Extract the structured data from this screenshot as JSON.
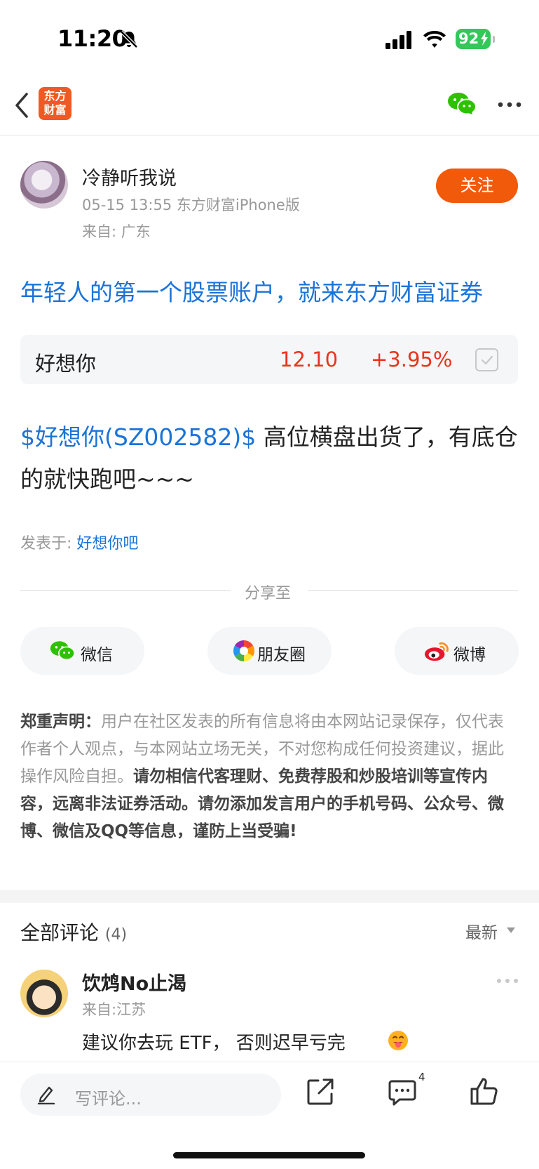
{
  "status_bar": {
    "time": "11:20",
    "battery": "92"
  },
  "nav": {
    "logo_text_line1": "东方",
    "logo_text_line2": "财富"
  },
  "post": {
    "author_name": "冷静听我说",
    "meta": "05-15 13:55 东方财富iPhone版",
    "location": "来自: 广东",
    "follow_label": "关注",
    "promo_link": "年轻人的第一个股票账户，就来东方财富证券",
    "stock": {
      "name": "好想你",
      "price": "12.10",
      "change": "+3.95%"
    },
    "stock_tag": "$好想你(SZ002582)$",
    "body_text": " 高位横盘出货了，有底仓的就快跑吧~~~",
    "posted_in_label": "发表于: ",
    "forum": "好想你吧"
  },
  "share": {
    "label": "分享至",
    "wechat": "微信",
    "moments": "朋友圈",
    "weibo": "微博"
  },
  "disclaimer": {
    "title": "郑重声明：",
    "normal": "用户在社区发表的所有信息将由本网站记录保存，仅代表作者个人观点，与本网站立场无关，不对您构成任何投资建议，据此操作风险自担。",
    "bold": "请勿相信代客理财、免费荐股和炒股培训等宣传内容，远离非法证券活动。请勿添加发言用户的手机号码、公众号、微博、微信及QQ等信息，谨防上当受骗!"
  },
  "comments": {
    "title": "全部评论",
    "count": "(4)",
    "sort": "最新",
    "items": [
      {
        "user": "饮鸩No止渴",
        "location": "来自:江苏",
        "text": "建议你去玩 ETF， 否则迟早亏完"
      }
    ]
  },
  "bottom_bar": {
    "input_placeholder": "写评论...",
    "comment_badge": "4"
  },
  "colors": {
    "accent_blue": "#1a73d9",
    "stock_up_red": "#e8341c",
    "follow_orange": "#f05a0a",
    "battery_green": "#34c759"
  }
}
